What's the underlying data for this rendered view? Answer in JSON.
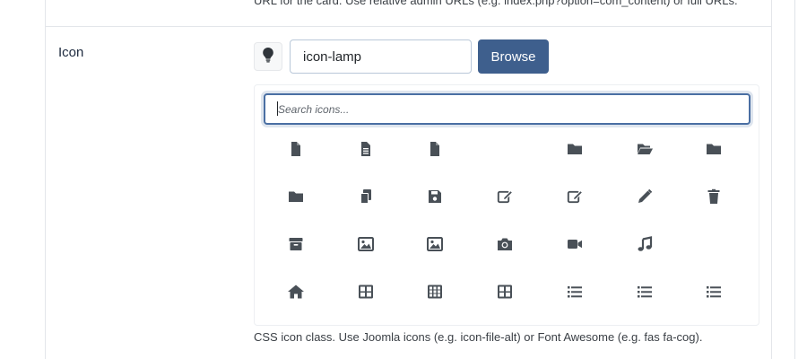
{
  "previous_field": {
    "help_text": "URL for the card. Use relative admin URLs (e.g. index.php?option=com_content) or full URLs."
  },
  "icon_field": {
    "label": "Icon",
    "preview_icon": "lightbulb-icon",
    "value": "icon-lamp",
    "browse_label": "Browse",
    "help_text": "CSS icon class. Use Joomla icons (e.g. icon-file-alt) or Font Awesome (e.g. fas fa-cog)."
  },
  "picker": {
    "search_placeholder": "Search icons...",
    "search_value": "",
    "icons": [
      "file-icon",
      "file-text-icon",
      "file-icon",
      "",
      "folder-icon",
      "folder-open-icon",
      "folder-icon",
      "folder-icon",
      "copy-icon",
      "save-icon",
      "edit-icon",
      "edit-icon",
      "pencil-icon",
      "trash-icon",
      "archive-icon",
      "image-icon",
      "image-icon",
      "camera-icon",
      "video-icon",
      "music-icon",
      "",
      "home-icon",
      "table-icon",
      "table-grid-icon",
      "table-icon",
      "list-icon",
      "list-icon",
      "list-icon"
    ]
  },
  "colors": {
    "primary_button": "#3e5f8d",
    "icon_glyph": "#495057",
    "focus_border": "#4a6fa3"
  }
}
